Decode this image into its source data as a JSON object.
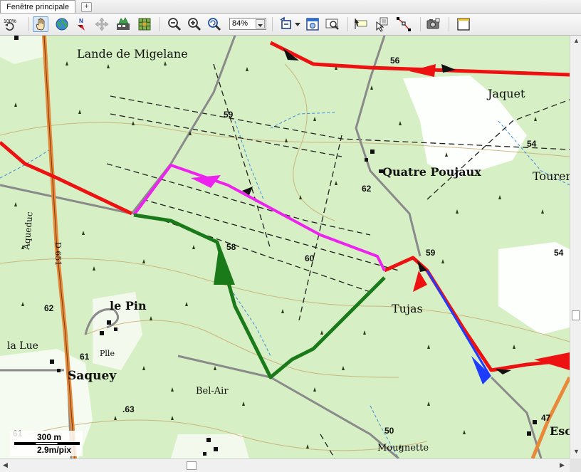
{
  "tabs": {
    "main": "Fenêtre principale",
    "add": "+"
  },
  "toolbar": {
    "zoom_value": "84%",
    "icons": [
      "zoom-100-icon",
      "pan-hand-icon",
      "globe-icon",
      "north-arrow-icon",
      "move-arrows-icon",
      "layers-icon",
      "grid-icon",
      "zoom-out-icon",
      "zoom-in-icon",
      "zoom-refresh-icon",
      "track-view-icon",
      "window-view-icon",
      "zoom-window-icon",
      "waypoint-icon",
      "select-point-icon",
      "route-edit-icon",
      "camera-icon",
      "new-window-icon"
    ],
    "hundred_label": "100%"
  },
  "map": {
    "places": {
      "lande": "Lande de Migelane",
      "jaquet": "Jaquet",
      "quatre": "Quatre Poujaux",
      "tourenne": "Tourenn",
      "lepin": "le Pin",
      "lalue": "la Lue",
      "saquey": "Saquey",
      "belair": "Bel-Air",
      "tujas": "Tujas",
      "mougnette": "Mougnette",
      "esc": "Esc",
      "aqueduc": "Aqueduc",
      "d651": "D 651",
      "plle": "Plle"
    },
    "elevations": {
      "e56": "56",
      "e59a": "59",
      "e54a": "54",
      "e62a": "62",
      "e58": "58",
      "e60": "60",
      "e59b": "59",
      "e54b": "54",
      "e62b": "62",
      "e61a": "61",
      "e63": ".63",
      "e50": "50",
      "e47": "47",
      "e61b": "61"
    },
    "route_colors": {
      "red": "#ee1111",
      "magenta": "#ee22ee",
      "green": "#1a7a1a",
      "blue": "#1e3cff"
    }
  },
  "scale": {
    "distance": "300 m",
    "resolution": "2.9m/pix"
  }
}
